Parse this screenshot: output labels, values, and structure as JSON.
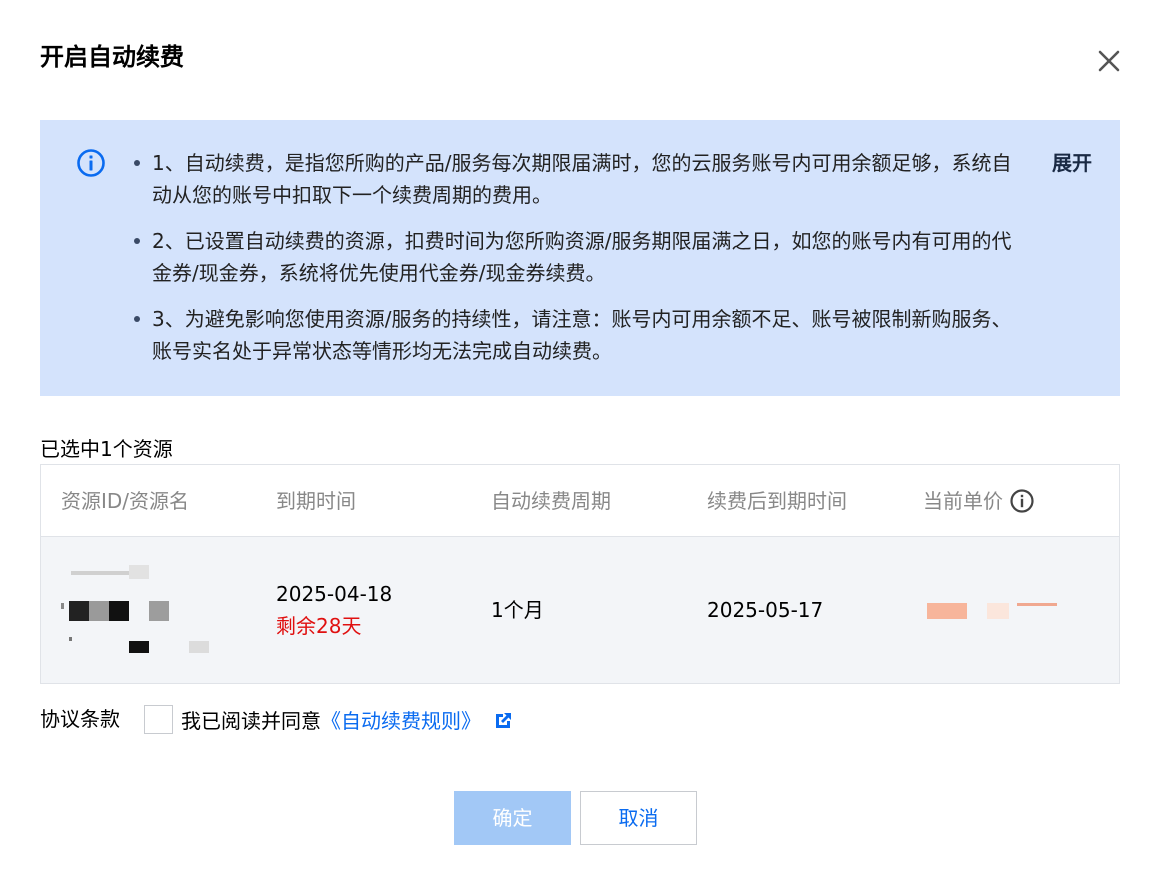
{
  "dialog": {
    "title": "开启自动续费"
  },
  "notice": {
    "items": [
      "1、自动续费，是指您所购的产品/服务每次期限届满时，您的云服务账号内可用余额足够，系统自动从您的账号中扣取下一个续费周期的费用。",
      "2、已设置自动续费的资源，扣费时间为您所购资源/服务期限届满之日，如您的账号内有可用的代金券/现金券，系统将优先使用代金券/现金券续费。",
      "3、为避免影响您使用资源/服务的持续性，请注意：账号内可用余额不足、账号被限制新购服务、账号实名处于异常状态等情形均无法完成自动续费。"
    ],
    "expand_label": "展开",
    "icon": "info-circle-icon"
  },
  "selection": {
    "count_text": "已选中1个资源"
  },
  "table": {
    "columns": [
      "资源ID/资源名",
      "到期时间",
      "自动续费周期",
      "续费后到期时间",
      "当前单价"
    ],
    "rows": [
      {
        "expire_date": "2025-04-18",
        "remaining": "剩余28天",
        "period": "1个月",
        "new_expire_date": "2025-05-17"
      }
    ]
  },
  "agreement": {
    "label": "协议条款",
    "text": "我已阅读并同意",
    "link_text": "《自动续费规则》"
  },
  "buttons": {
    "confirm": "确定",
    "cancel": "取消"
  },
  "colors": {
    "notice_bg": "#d4e3fc",
    "primary": "#0a6bf0",
    "primary_disabled": "#a2c8f6",
    "danger": "#e01010"
  }
}
